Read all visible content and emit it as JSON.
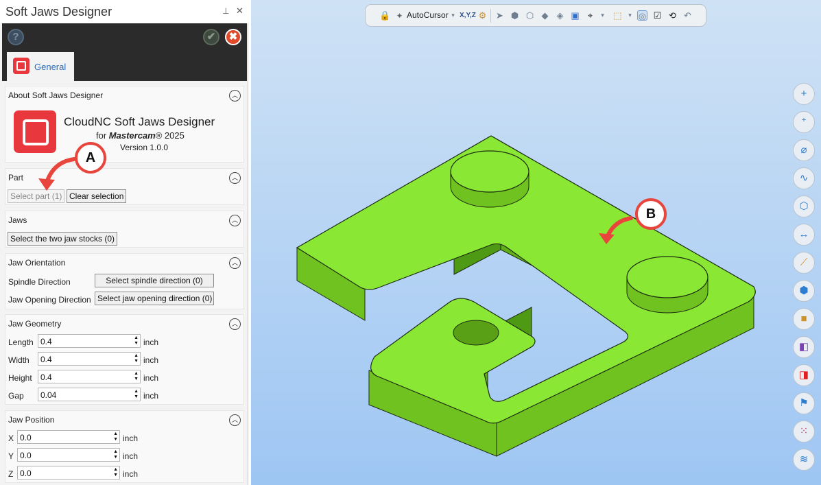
{
  "panel": {
    "title": "Soft Jaws Designer",
    "pin_glyph": "⊥",
    "close_glyph": "✕",
    "help_glyph": "?",
    "ok_glyph": "✔",
    "close_btn_glyph": "✖",
    "tab_label": "General"
  },
  "about": {
    "title": "About Soft Jaws Designer",
    "product_name": "CloudNC Soft Jaws Designer",
    "for_prefix": "for",
    "for_product": "Mastercam",
    "for_suffix": "® 2025",
    "version": "Version 1.0.0"
  },
  "part": {
    "title": "Part",
    "select_label": "Select part (1)",
    "clear_label": "Clear selection"
  },
  "jaws": {
    "title": "Jaws",
    "select_label": "Select the two jaw stocks (0)"
  },
  "orientation": {
    "title": "Jaw Orientation",
    "spindle_label": "Spindle Direction",
    "spindle_button": "Select spindle direction (0)",
    "opening_label": "Jaw Opening Direction",
    "opening_button": "Select jaw opening direction (0)"
  },
  "geometry": {
    "title": "Jaw Geometry",
    "fields": [
      {
        "label": "Length",
        "value": "0.4",
        "unit": "inch"
      },
      {
        "label": "Width",
        "value": "0.4",
        "unit": "inch"
      },
      {
        "label": "Height",
        "value": "0.4",
        "unit": "inch"
      },
      {
        "label": "Gap",
        "value": "0.04",
        "unit": "inch"
      }
    ]
  },
  "position": {
    "title": "Jaw Position",
    "fields": [
      {
        "label": "X",
        "value": "0.0",
        "unit": "inch"
      },
      {
        "label": "Y",
        "value": "0.0",
        "unit": "inch"
      },
      {
        "label": "Z",
        "value": "0.0",
        "unit": "inch"
      }
    ]
  },
  "toolbar": {
    "autocursor_label": "AutoCursor",
    "xyz_label": "X,Y,Z",
    "dropdown_glyph": "▾"
  },
  "callouts": {
    "a": "A",
    "b": "B"
  },
  "right_tools": [
    {
      "icon": "plus-point-icon",
      "glyph": "+"
    },
    {
      "icon": "point-line-icon",
      "glyph": "⁺"
    },
    {
      "icon": "circle-slash-icon",
      "glyph": "⌀"
    },
    {
      "icon": "spline-icon",
      "glyph": "∿"
    },
    {
      "icon": "wireframe-cube-icon",
      "glyph": "⬡"
    },
    {
      "icon": "dimension-icon",
      "glyph": "↔"
    },
    {
      "icon": "measure-tape-icon",
      "glyph": "⟋"
    },
    {
      "icon": "solid-cube-icon",
      "glyph": "⬢"
    },
    {
      "icon": "box-icon",
      "glyph": "■"
    },
    {
      "icon": "purple-block-icon",
      "glyph": "◧"
    },
    {
      "icon": "red-block-icon",
      "glyph": "◨"
    },
    {
      "icon": "flag-icon",
      "glyph": "⚑"
    },
    {
      "icon": "grid-color-icon",
      "glyph": "⁙"
    },
    {
      "icon": "layers-icon",
      "glyph": "≋"
    }
  ],
  "colors": {
    "brand_red": "#e8383d",
    "part_green": "#8ae834",
    "callout_red": "#e8453c",
    "link_blue": "#2a6ebb"
  }
}
